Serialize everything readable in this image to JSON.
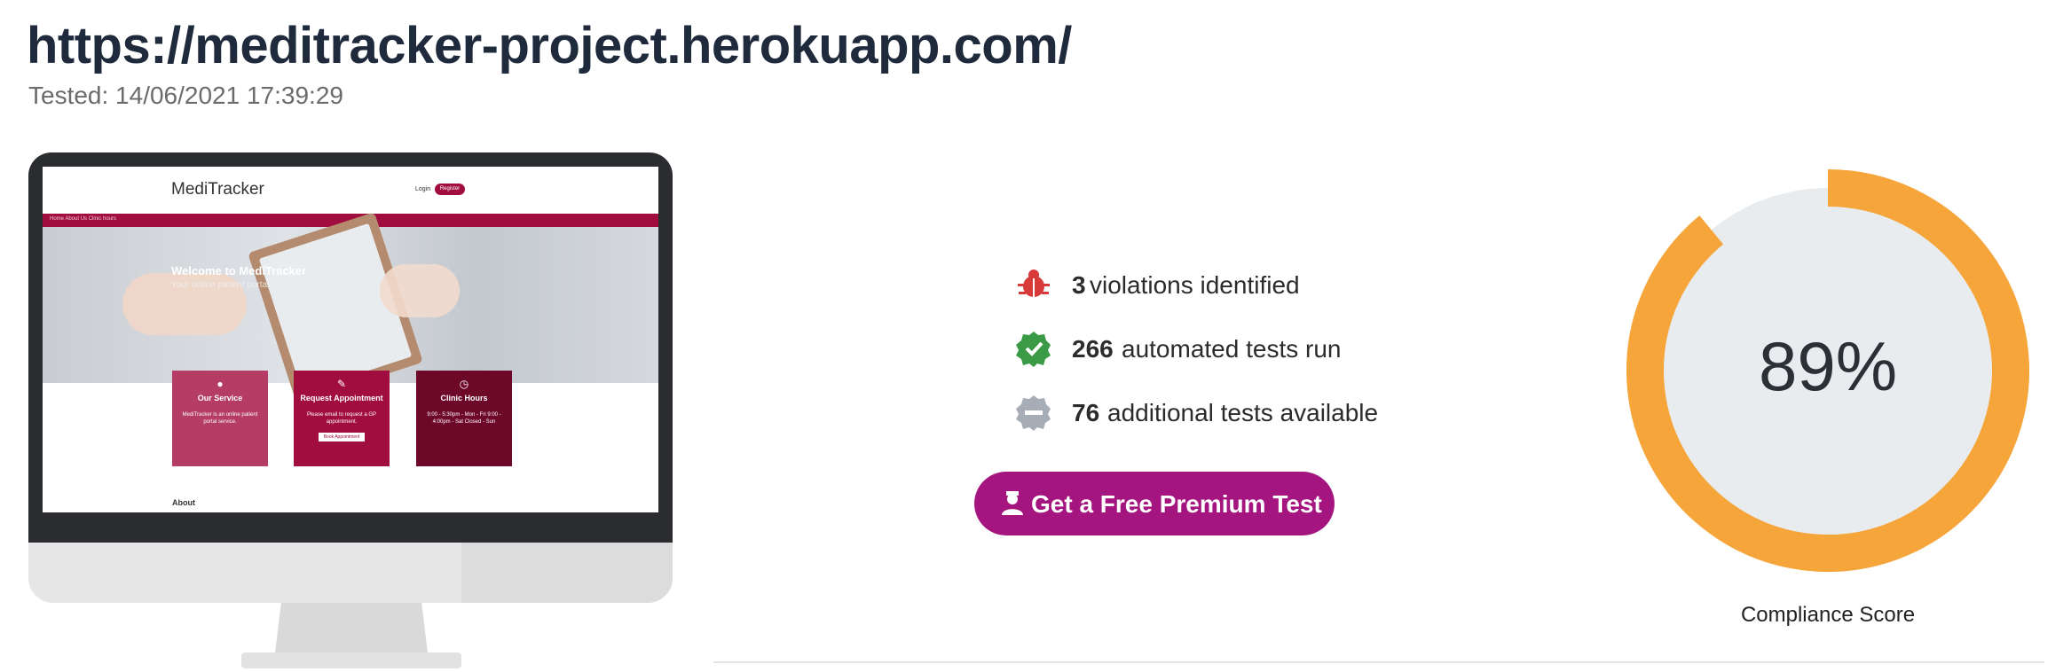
{
  "header": {
    "url": "https://meditracker-project.herokuapp.com/",
    "tested": "Tested: 14/06/2021 17:39:29"
  },
  "preview": {
    "logo": "MediTracker",
    "login": "Login",
    "register": "Register",
    "nav_links": "Home   About Us   Clinic hours",
    "hero_title": "Welcome to MediTracker",
    "hero_subtitle": "Your online patient portal",
    "cards": [
      {
        "title": "Our Service",
        "body": "MediTracker is an online patient portal service.",
        "icon": "user-icon"
      },
      {
        "title": "Request Appointment",
        "body": "Please email to request a GP appointment.",
        "button": "Book Appointment",
        "icon": "pencil-icon"
      },
      {
        "title": "Clinic Hours",
        "body": "9:00 - 5:30pm - Mon - Fri  9:00 - 4:00pm - Sat  Closed - Sun",
        "icon": "clock-icon"
      }
    ],
    "about": "About"
  },
  "stats": [
    {
      "num": "3",
      "text": "violations identified",
      "icon": "bug-icon",
      "color": "#d83a3a"
    },
    {
      "num": "266",
      "text": "automated tests run",
      "icon": "check-badge-icon",
      "color": "#3a9a46"
    },
    {
      "num": "76",
      "text": "additional tests available",
      "icon": "minus-badge-icon",
      "color": "#a7adb6"
    }
  ],
  "cta": {
    "label": "Get a Free Premium Test",
    "icon": "agent-icon",
    "color": "#a4157f"
  },
  "score": {
    "value": "89%",
    "fraction": 0.89,
    "label": "Compliance Score",
    "fill_color": "#f5a53a",
    "track_color": "#e9ecef"
  }
}
